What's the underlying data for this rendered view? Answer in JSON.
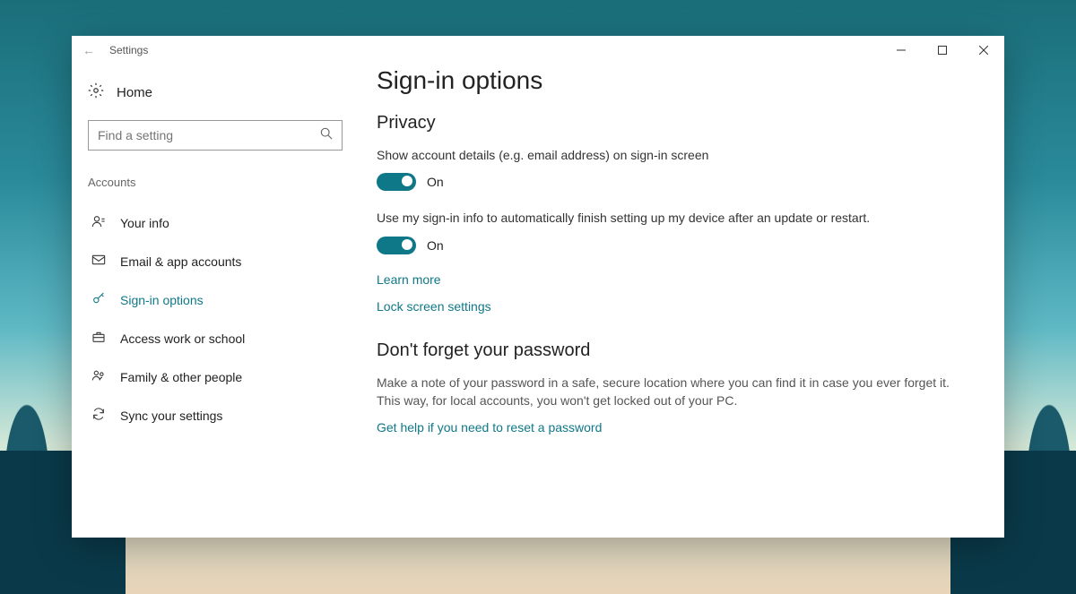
{
  "window": {
    "title": "Settings"
  },
  "home_label": "Home",
  "search_placeholder": "Find a setting",
  "category": "Accounts",
  "nav": {
    "your_info": "Your info",
    "email": "Email & app accounts",
    "signin": "Sign-in options",
    "work": "Access work or school",
    "family": "Family & other people",
    "sync": "Sync your settings"
  },
  "page": {
    "title": "Sign-in options",
    "privacy_heading": "Privacy",
    "show_details_label": "Show account details (e.g. email address) on sign-in screen",
    "show_details_state": "On",
    "auto_signin_label": "Use my sign-in info to automatically finish setting up my device after an update or restart.",
    "auto_signin_state": "On",
    "learn_more": "Learn more",
    "lock_screen": "Lock screen settings",
    "forget_heading": "Don't forget your password",
    "forget_body": "Make a note of your password in a safe, secure location where you can find it in case you ever forget it. This way, for local accounts, you won't get locked out of your PC.",
    "reset_help": "Get help if you need to reset a password"
  }
}
